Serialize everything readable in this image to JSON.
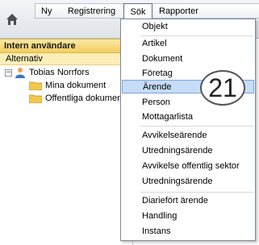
{
  "menubar": {
    "items": [
      "Ny",
      "Registrering",
      "Sök",
      "Rapporter"
    ]
  },
  "panel": {
    "header": "Intern användare",
    "subheader": "Alternativ",
    "tree": {
      "user": "Tobias Norrfors",
      "folders": [
        "Mina dokument",
        "Offentliga dokumen"
      ]
    }
  },
  "dropdown": {
    "items": [
      "Objekt",
      "Artikel",
      "Dokument",
      "Företag",
      "Ärende",
      "Person",
      "Mottagarlista",
      "Avvikelseärende",
      "Utredningsärende",
      "Avvikelse offentlig sektor",
      "Utredningsärende",
      "Diariefört ärende",
      "Handling",
      "Instans"
    ],
    "highlighted": "Ärende"
  },
  "callout": {
    "number": "21"
  },
  "colors": {
    "panel_header": "#f2cf63",
    "highlight": "#c7dcf6",
    "highlight_border": "#7aa6e0"
  }
}
